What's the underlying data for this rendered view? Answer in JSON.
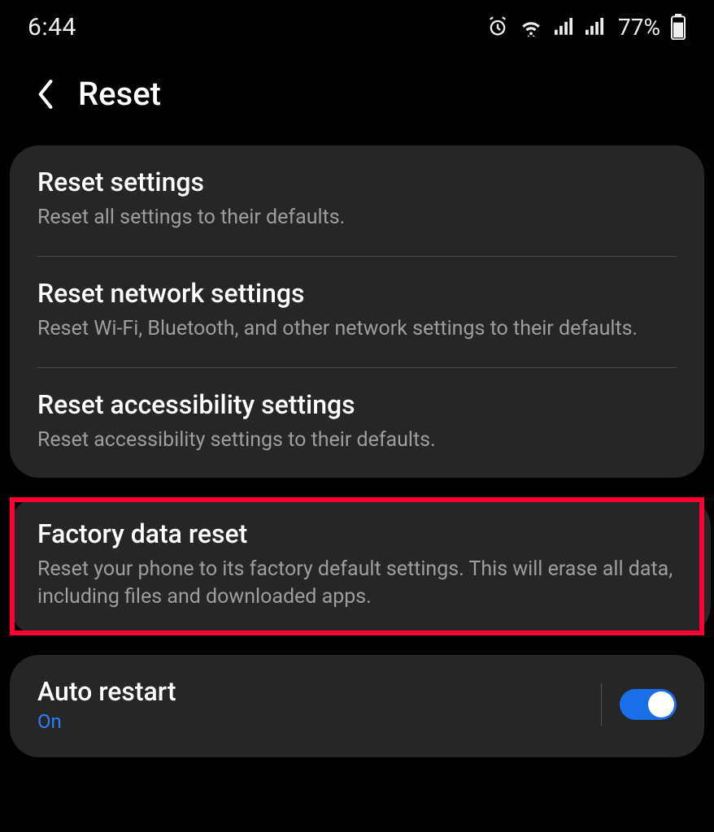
{
  "status": {
    "time": "6:44",
    "battery_pct": "77%",
    "icons": {
      "alarm": "alarm-icon",
      "wifi": "wifi-icon",
      "signal1": "signal-bars-icon",
      "signal2": "signal-bars-icon",
      "battery": "battery-icon"
    }
  },
  "header": {
    "title": "Reset",
    "back_icon": "chevron-left-icon"
  },
  "groups": [
    {
      "items": [
        {
          "title": "Reset settings",
          "subtitle": "Reset all settings to their defaults."
        },
        {
          "title": "Reset network settings",
          "subtitle": "Reset Wi-Fi, Bluetooth, and other network settings to their defaults."
        },
        {
          "title": "Reset accessibility settings",
          "subtitle": "Reset accessibility settings to their defaults."
        }
      ]
    }
  ],
  "factory": {
    "title": "Factory data reset",
    "subtitle": "Reset your phone to its factory default settings. This will erase all data, including files and downloaded apps.",
    "highlighted": true
  },
  "auto_restart": {
    "title": "Auto restart",
    "state_label": "On",
    "enabled": true
  }
}
